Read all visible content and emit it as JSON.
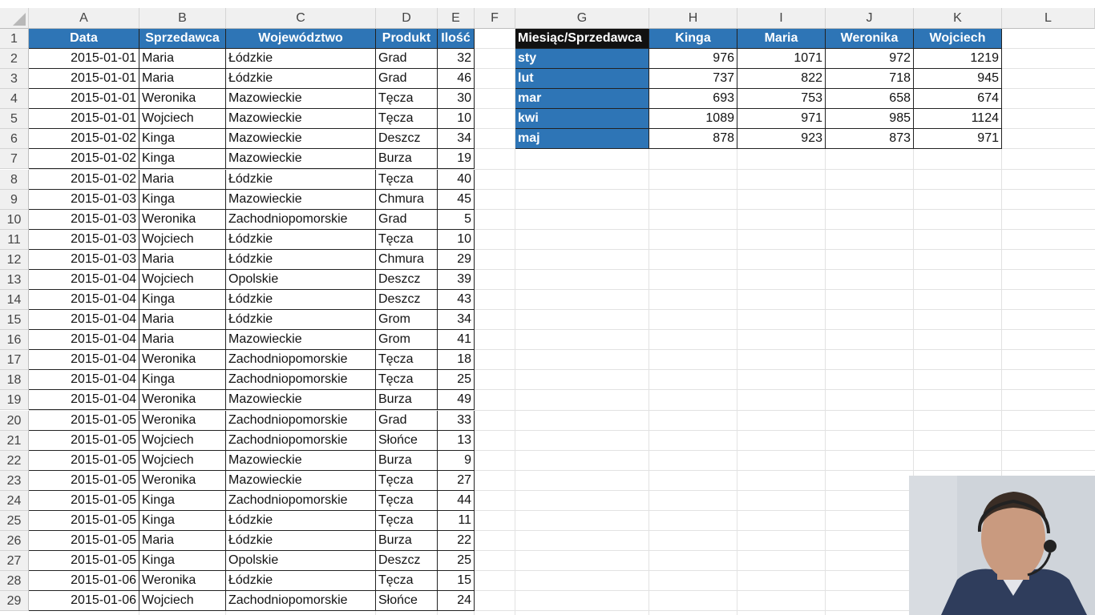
{
  "columns": [
    "A",
    "B",
    "C",
    "D",
    "E",
    "F",
    "G",
    "H",
    "I",
    "J",
    "K",
    "L"
  ],
  "rows": [
    "1",
    "2",
    "3",
    "4",
    "5",
    "6",
    "7",
    "8",
    "9",
    "10",
    "11",
    "12",
    "13",
    "14",
    "15",
    "16",
    "17",
    "18",
    "19",
    "20",
    "21",
    "22",
    "23",
    "24",
    "25",
    "26",
    "27",
    "28",
    "29"
  ],
  "table": {
    "headers": [
      "Data",
      "Sprzedawca",
      "Województwo",
      "Produkt",
      "Ilość"
    ],
    "rows": [
      [
        "2015-01-01",
        "Maria",
        "Łódzkie",
        "Grad",
        "32"
      ],
      [
        "2015-01-01",
        "Maria",
        "Łódzkie",
        "Grad",
        "46"
      ],
      [
        "2015-01-01",
        "Weronika",
        "Mazowieckie",
        "Tęcza",
        "30"
      ],
      [
        "2015-01-01",
        "Wojciech",
        "Mazowieckie",
        "Tęcza",
        "10"
      ],
      [
        "2015-01-02",
        "Kinga",
        "Mazowieckie",
        "Deszcz",
        "34"
      ],
      [
        "2015-01-02",
        "Kinga",
        "Mazowieckie",
        "Burza",
        "19"
      ],
      [
        "2015-01-02",
        "Maria",
        "Łódzkie",
        "Tęcza",
        "40"
      ],
      [
        "2015-01-03",
        "Kinga",
        "Mazowieckie",
        "Chmura",
        "45"
      ],
      [
        "2015-01-03",
        "Weronika",
        "Zachodniopomorskie",
        "Grad",
        "5"
      ],
      [
        "2015-01-03",
        "Wojciech",
        "Łódzkie",
        "Tęcza",
        "10"
      ],
      [
        "2015-01-03",
        "Maria",
        "Łódzkie",
        "Chmura",
        "29"
      ],
      [
        "2015-01-04",
        "Wojciech",
        "Opolskie",
        "Deszcz",
        "39"
      ],
      [
        "2015-01-04",
        "Kinga",
        "Łódzkie",
        "Deszcz",
        "43"
      ],
      [
        "2015-01-04",
        "Maria",
        "Łódzkie",
        "Grom",
        "34"
      ],
      [
        "2015-01-04",
        "Maria",
        "Mazowieckie",
        "Grom",
        "41"
      ],
      [
        "2015-01-04",
        "Weronika",
        "Zachodniopomorskie",
        "Tęcza",
        "18"
      ],
      [
        "2015-01-04",
        "Kinga",
        "Zachodniopomorskie",
        "Tęcza",
        "25"
      ],
      [
        "2015-01-04",
        "Weronika",
        "Mazowieckie",
        "Burza",
        "49"
      ],
      [
        "2015-01-05",
        "Weronika",
        "Zachodniopomorskie",
        "Grad",
        "33"
      ],
      [
        "2015-01-05",
        "Wojciech",
        "Zachodniopomorskie",
        "Słońce",
        "13"
      ],
      [
        "2015-01-05",
        "Wojciech",
        "Mazowieckie",
        "Burza",
        "9"
      ],
      [
        "2015-01-05",
        "Weronika",
        "Mazowieckie",
        "Tęcza",
        "27"
      ],
      [
        "2015-01-05",
        "Kinga",
        "Zachodniopomorskie",
        "Tęcza",
        "44"
      ],
      [
        "2015-01-05",
        "Kinga",
        "Łódzkie",
        "Tęcza",
        "11"
      ],
      [
        "2015-01-05",
        "Maria",
        "Łódzkie",
        "Burza",
        "22"
      ],
      [
        "2015-01-05",
        "Kinga",
        "Opolskie",
        "Deszcz",
        "25"
      ],
      [
        "2015-01-06",
        "Weronika",
        "Łódzkie",
        "Tęcza",
        "15"
      ],
      [
        "2015-01-06",
        "Wojciech",
        "Zachodniopomorskie",
        "Słońce",
        "24"
      ]
    ]
  },
  "summary": {
    "corner": "Miesiąc/Sprzedawca",
    "headers": [
      "Kinga",
      "Maria",
      "Weronika",
      "Wojciech"
    ],
    "rows": [
      {
        "label": "sty",
        "values": [
          "976",
          "1071",
          "972",
          "1219"
        ]
      },
      {
        "label": "lut",
        "values": [
          "737",
          "822",
          "718",
          "945"
        ]
      },
      {
        "label": "mar",
        "values": [
          "693",
          "753",
          "658",
          "674"
        ]
      },
      {
        "label": "kwi",
        "values": [
          "1089",
          "971",
          "985",
          "1124"
        ]
      },
      {
        "label": "maj",
        "values": [
          "878",
          "923",
          "873",
          "971"
        ]
      }
    ]
  },
  "colors": {
    "header_blue": "#2e75b6",
    "header_black": "#111111",
    "grid": "#e2e2e2",
    "headers_bg": "#f0f0f0"
  },
  "webcam": {
    "icon": "presenter-video"
  }
}
